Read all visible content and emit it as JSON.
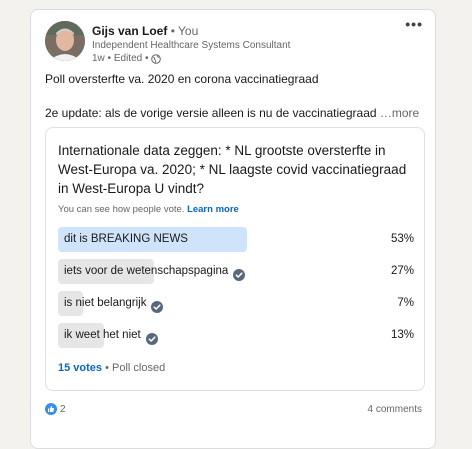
{
  "post": {
    "author_name": "Gijs van Loef",
    "author_tag": " • You",
    "author_title": "Independent Healthcare Systems Consultant",
    "meta": "1w • Edited •",
    "more_label": "•••",
    "text_line1": "Poll oversterfte va. 2020 en corona vaccinatiegraad",
    "text_line2": "2e update: als de vorige versie alleen is nu de vaccinatiegraad",
    "see_more": "…more"
  },
  "poll": {
    "question": "Internationale data zeggen: * NL grootste oversterfte in West-Europa va. 2020; * NL laagste covid vaccinatiegraad in West-Europa U vindt?",
    "note": "You can see how people vote.",
    "learn_more": "Learn more",
    "options": [
      {
        "label": "dit is BREAKING NEWS",
        "percent": "53%",
        "fraction": 0.53,
        "selected": true,
        "verified": false
      },
      {
        "label": "iets voor de wetenschapspagina",
        "percent": "27%",
        "fraction": 0.27,
        "selected": false,
        "verified": true
      },
      {
        "label": "is niet belangrijk",
        "percent": "7%",
        "fraction": 0.07,
        "selected": false,
        "verified": true
      },
      {
        "label": "ik weet het niet",
        "percent": "13%",
        "fraction": 0.13,
        "selected": false,
        "verified": true
      }
    ],
    "votes": "15 votes",
    "status": " • Poll closed"
  },
  "social": {
    "reaction_count": "2",
    "comments": "4 comments"
  },
  "colors": {
    "accent": "#0a66c2",
    "selected_fill": "#cfe4fa",
    "option_fill": "#e6e6e6",
    "check_icon": "#56687a"
  },
  "icons": [
    "globe-icon",
    "verified-check-icon",
    "like-icon",
    "more-icon"
  ]
}
